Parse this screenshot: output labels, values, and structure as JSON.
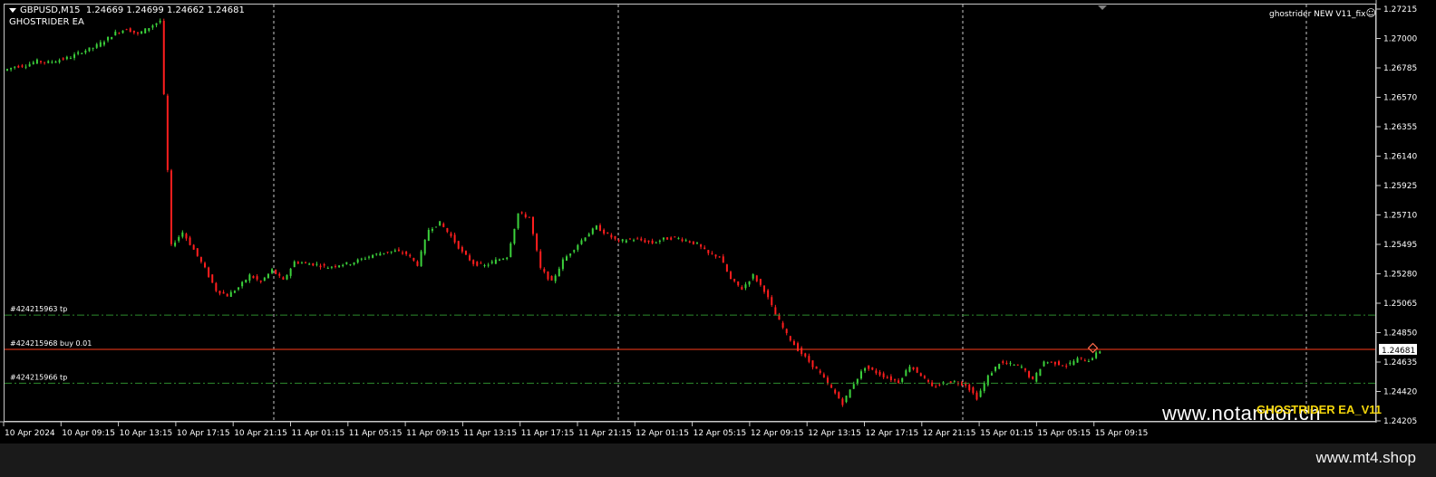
{
  "header": {
    "symbol_line": "GBPUSD,M15  1.24669 1.24699 1.24662 1.24681",
    "ea_name": "GHOSTRIDER EA",
    "indicator_label": "ghostrider NEW V11_fix",
    "smiley": "☺"
  },
  "price_axis": {
    "labels": [
      "1.27215",
      "1.27000",
      "1.26785",
      "1.26570",
      "1.26355",
      "1.26140",
      "1.25925",
      "1.25710",
      "1.25495",
      "1.25280",
      "1.25065",
      "1.24850",
      "1.24635",
      "1.24420",
      "1.24205"
    ],
    "current_price": "1.24681",
    "current_price_color": "#ffffff"
  },
  "time_axis": {
    "labels": [
      "10 Apr 2024",
      "10 Apr 09:15",
      "10 Apr 13:15",
      "10 Apr 17:15",
      "10 Apr 21:15",
      "11 Apr 01:15",
      "11 Apr 05:15",
      "11 Apr 09:15",
      "11 Apr 13:15",
      "11 Apr 17:15",
      "11 Apr 21:15",
      "12 Apr 01:15",
      "12 Apr 05:15",
      "12 Apr 09:15",
      "12 Apr 13:15",
      "12 Apr 17:15",
      "12 Apr 21:15",
      "15 Apr 01:15",
      "15 Apr 05:15",
      "15 Apr 09:15"
    ]
  },
  "orders": [
    {
      "label": "#424215963 tp",
      "price": 1.24935,
      "color": "#2e8b2e"
    },
    {
      "label": "#424215968 buy 0.01",
      "price": 1.24681,
      "color": "#ff3b1a"
    },
    {
      "label": "#424215966 tp",
      "price": 1.2443,
      "color": "#2e8b2e"
    }
  ],
  "watermarks": {
    "site": "www.notandor.cn",
    "ea": "GHOSTRIDER EA_V11"
  },
  "footer": {
    "text": "www.mt4.shop"
  },
  "colors": {
    "bull": "#3cd23c",
    "bear": "#ff1e1e",
    "grid": "#c8c8c8",
    "background": "#000000"
  },
  "chart_data": {
    "type": "candlestick",
    "symbol": "GBPUSD",
    "timeframe": "M15",
    "ylim": [
      1.2415,
      1.2724
    ],
    "series": [
      {
        "name": "close",
        "values": [
          1.2678,
          1.2679,
          1.2682,
          1.2681,
          1.2683,
          1.2685,
          1.2689,
          1.2692,
          1.2697,
          1.2703,
          1.2706,
          1.2702,
          1.2707,
          1.2712,
          1.2545,
          1.2555,
          1.2542,
          1.2528,
          1.2512,
          1.2508,
          1.2514,
          1.2523,
          1.2518,
          1.2527,
          1.2519,
          1.2533,
          1.2532,
          1.2531,
          1.2529,
          1.2531,
          1.2532,
          1.2535,
          1.2538,
          1.254,
          1.2541,
          1.2539,
          1.2531,
          1.2557,
          1.2562,
          1.2552,
          1.254,
          1.2532,
          1.253,
          1.2534,
          1.2537,
          1.2569,
          1.2566,
          1.2528,
          1.2518,
          1.2534,
          1.2543,
          1.2552,
          1.2559,
          1.2553,
          1.2548,
          1.255,
          1.2549,
          1.2547,
          1.255,
          1.2551,
          1.2549,
          1.2546,
          1.2539,
          1.2537,
          1.252,
          1.2513,
          1.2523,
          1.2512,
          1.2494,
          1.2479,
          1.2468,
          1.2459,
          1.245,
          1.2439,
          1.2428,
          1.2443,
          1.2455,
          1.2451,
          1.2447,
          1.2444,
          1.2456,
          1.2449,
          1.244,
          1.2443,
          1.2444,
          1.2442,
          1.2432,
          1.2448,
          1.2458,
          1.2457,
          1.2455,
          1.2445,
          1.2459,
          1.2458,
          1.2456,
          1.2461,
          1.246,
          1.2467
        ]
      }
    ]
  }
}
